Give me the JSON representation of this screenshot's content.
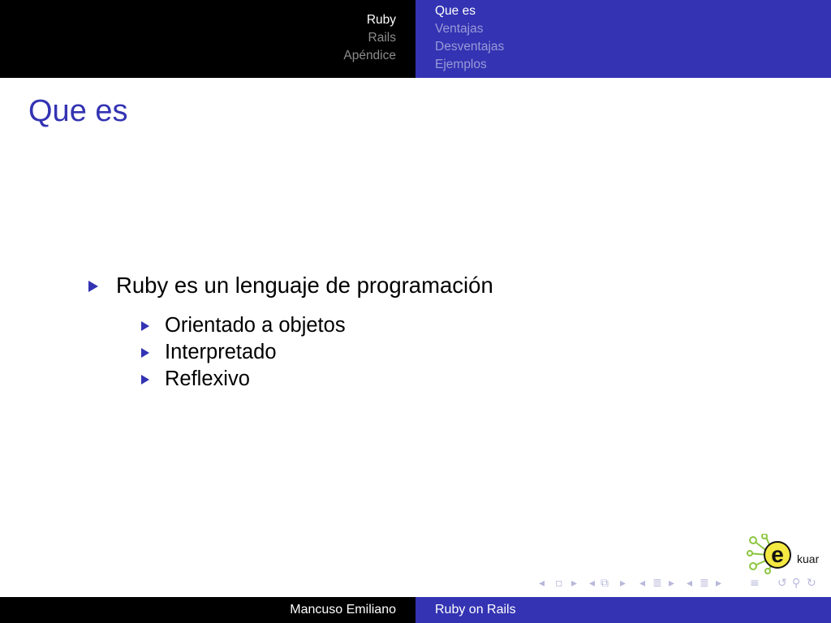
{
  "header": {
    "sections": [
      "Ruby",
      "Rails",
      "Apéndice"
    ],
    "active_section": "Ruby",
    "subsections": [
      "Que es",
      "Ventajas",
      "Desventajas",
      "Ejemplos"
    ],
    "active_subsection": "Que es"
  },
  "frame": {
    "title": "Que es",
    "items": [
      {
        "text": "Ruby es un lenguaje de programación",
        "subitems": [
          "Orientado a objetos",
          "Interpretado",
          "Reflexivo"
        ]
      }
    ]
  },
  "logo": {
    "text": "kuar",
    "letter": "e"
  },
  "footer": {
    "author": "Mancuso Emiliano",
    "title": "Ruby on Rails"
  },
  "colors": {
    "beamer_blue": "#3333b3",
    "dark": "#000000"
  }
}
